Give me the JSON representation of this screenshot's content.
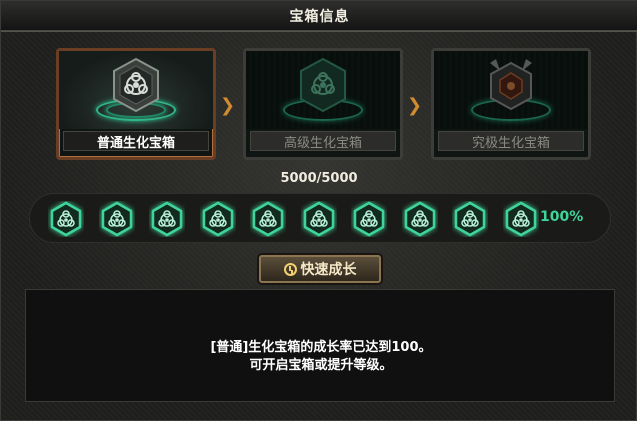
{
  "window": {
    "title": "宝箱信息"
  },
  "chests": [
    {
      "label": "普通生化宝箱",
      "state": "active"
    },
    {
      "label": "高级生化宝箱",
      "state": "locked"
    },
    {
      "label": "究极生化宝箱",
      "state": "locked"
    }
  ],
  "progress": {
    "text": "5000/5000",
    "percent_label": "100%",
    "value": 1.0,
    "segments": 10
  },
  "fast_grow_button": {
    "label": "快速成长"
  },
  "message": {
    "line1": "[普通]生化宝箱的成长率已达到100。",
    "line2": "可开启宝箱或提升等级。"
  },
  "colors": {
    "accent_green": "#3fd49a",
    "active_border": "#6a3e24",
    "button_gold": "#8a7550",
    "arrow": "#d08a30"
  },
  "icons": {
    "chest_node": "biohazard-hex-icon",
    "arrow": "chevron-right-icon",
    "button": "clock-icon"
  }
}
